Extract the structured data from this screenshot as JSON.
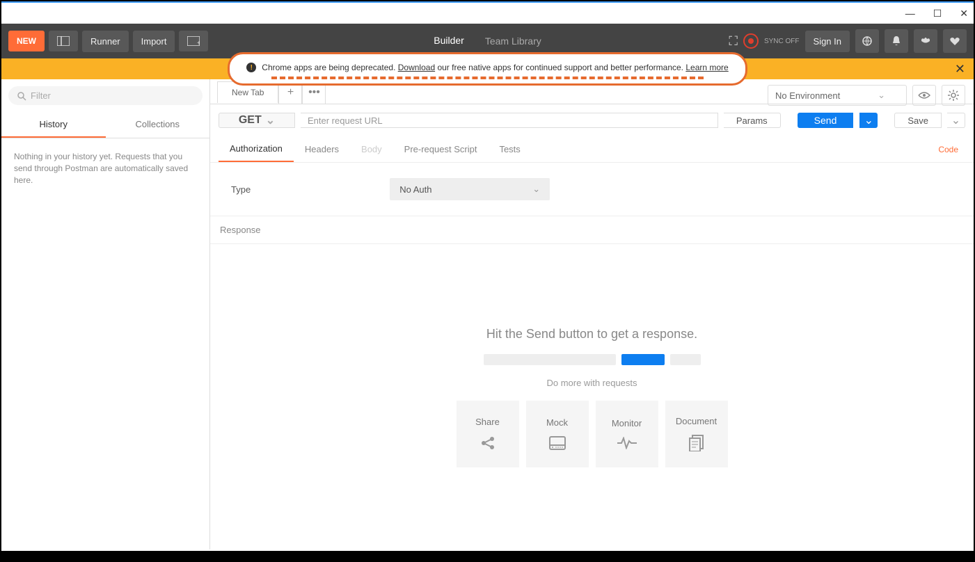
{
  "titlebar": {
    "minimize": "—",
    "maximize": "☐",
    "close": "✕"
  },
  "toolbar": {
    "new": "NEW",
    "runner": "Runner",
    "import": "Import",
    "builder": "Builder",
    "team_library": "Team Library",
    "sync_off": "SYNC OFF",
    "sign_in": "Sign In"
  },
  "banner": {
    "text1": "Chrome apps are being deprecated. ",
    "download": "Download",
    "text2": " our free native apps for continued support and better performance. ",
    "learn": "Learn more",
    "close": "✕"
  },
  "sidebar": {
    "filter_placeholder": "Filter",
    "tabs": {
      "history": "History",
      "collections": "Collections"
    },
    "empty": "Nothing in your history yet. Requests that you send through Postman are automatically saved here."
  },
  "env": {
    "label": "No Environment"
  },
  "tabs": {
    "new_tab": "New Tab",
    "plus": "+",
    "more": "•••"
  },
  "request": {
    "method": "GET",
    "url_placeholder": "Enter request URL",
    "params": "Params",
    "send": "Send",
    "save": "Save"
  },
  "subtabs": {
    "authorization": "Authorization",
    "headers": "Headers",
    "body": "Body",
    "prerequest": "Pre-request Script",
    "tests": "Tests",
    "code": "Code"
  },
  "auth": {
    "type_label": "Type",
    "value": "No Auth"
  },
  "response": {
    "header": "Response",
    "empty_title": "Hit the Send button to get a response.",
    "do_more": "Do more with requests",
    "cards": {
      "share": "Share",
      "mock": "Mock",
      "monitor": "Monitor",
      "document": "Document"
    }
  }
}
